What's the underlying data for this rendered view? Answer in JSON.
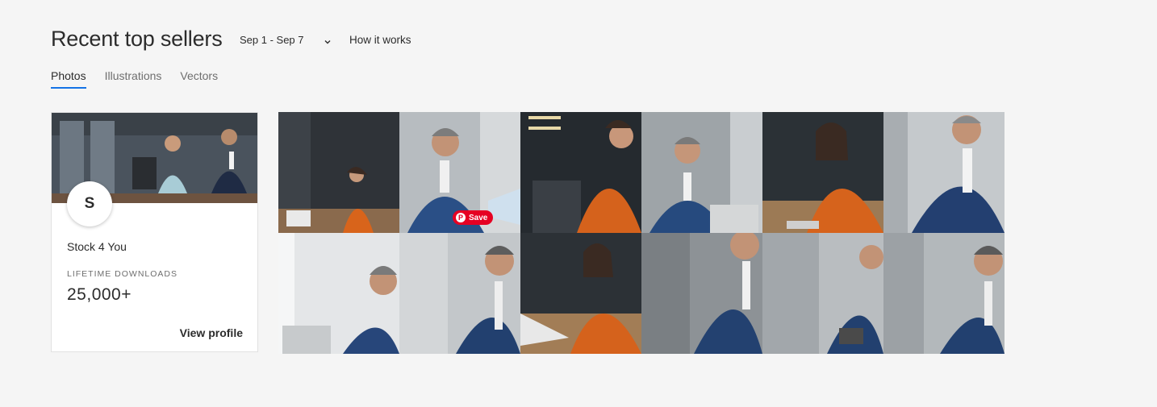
{
  "header": {
    "title": "Recent top sellers",
    "date_range": "Sep 1 - Sep 7",
    "how_it_works": "How it works"
  },
  "tabs": [
    {
      "label": "Photos",
      "active": true
    },
    {
      "label": "Illustrations",
      "active": false
    },
    {
      "label": "Vectors",
      "active": false
    }
  ],
  "seller": {
    "avatar_letter": "S",
    "name": "Stock 4 You",
    "downloads_label": "LIFETIME DOWNLOADS",
    "downloads_value": "25,000+",
    "view_profile": "View profile"
  },
  "pinterest": {
    "save_label": "Save",
    "pin_glyph": "P"
  },
  "icons": {
    "date_chevron": "chevron-down-icon"
  },
  "colors": {
    "tab_underline": "#1473e6",
    "save_button": "#e60023",
    "background": "#f5f5f5"
  }
}
